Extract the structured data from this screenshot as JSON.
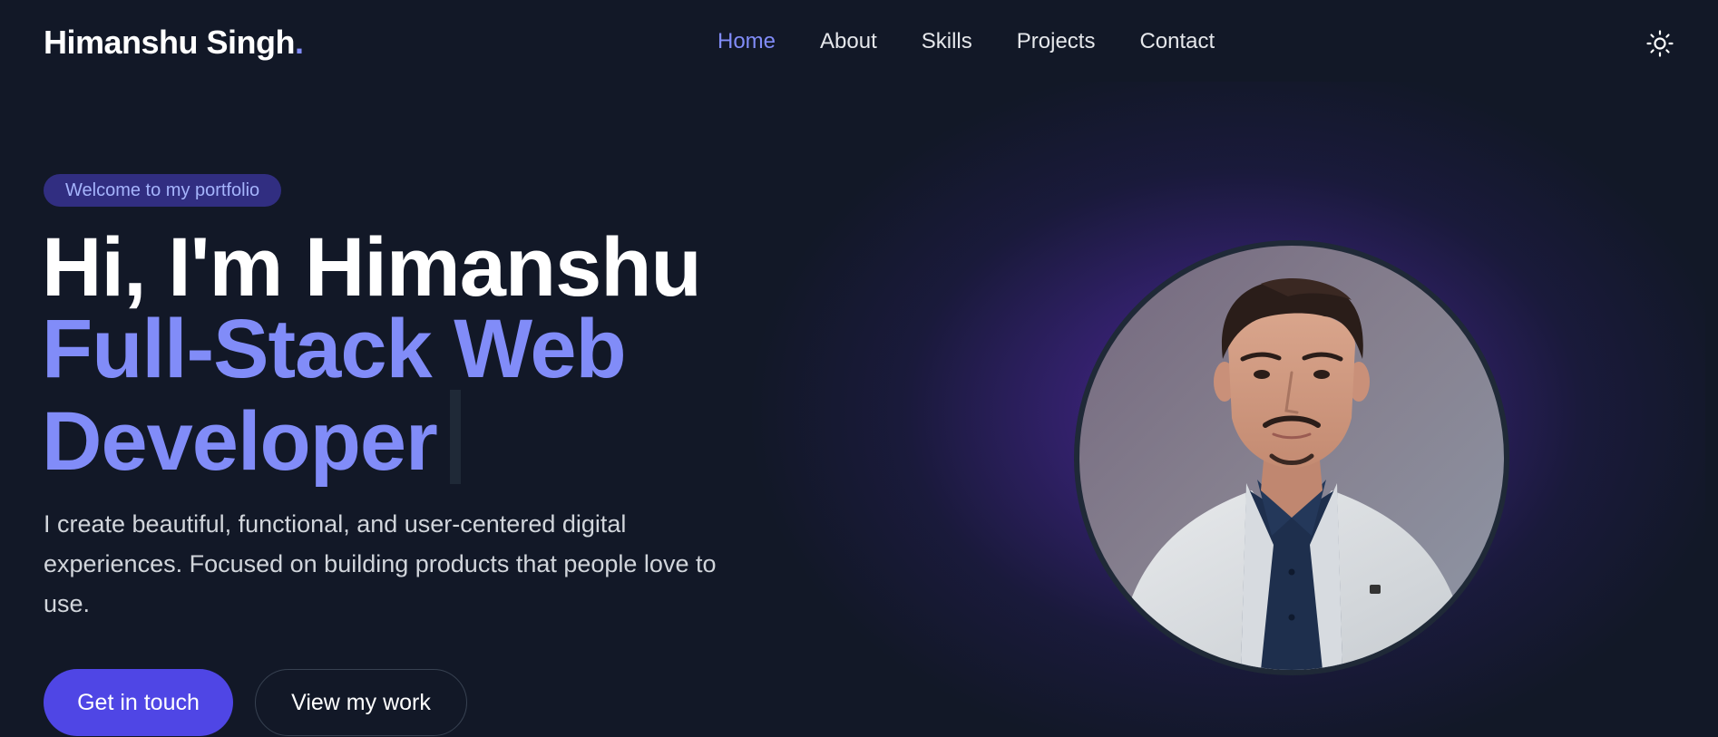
{
  "header": {
    "logo_text": "Himanshu Singh",
    "logo_dot": ".",
    "nav": [
      {
        "label": "Home",
        "active": true
      },
      {
        "label": "About",
        "active": false
      },
      {
        "label": "Skills",
        "active": false
      },
      {
        "label": "Projects",
        "active": false
      },
      {
        "label": "Contact",
        "active": false
      }
    ],
    "theme_toggle_icon": "sun-icon"
  },
  "hero": {
    "badge": "Welcome to my portfolio",
    "headline_line1": "Hi, I'm Himanshu",
    "headline_line2a": "Full-Stack Web",
    "headline_line2b": "Developer",
    "description": "I create beautiful, functional, and user-centered digital experiences. Focused on building products that people love to use.",
    "primary_button": "Get in touch",
    "secondary_button": "View my work"
  },
  "colors": {
    "background": "#121827",
    "accent": "#818cf8",
    "primary_button": "#4f46e5",
    "badge_bg": "#312e81"
  }
}
